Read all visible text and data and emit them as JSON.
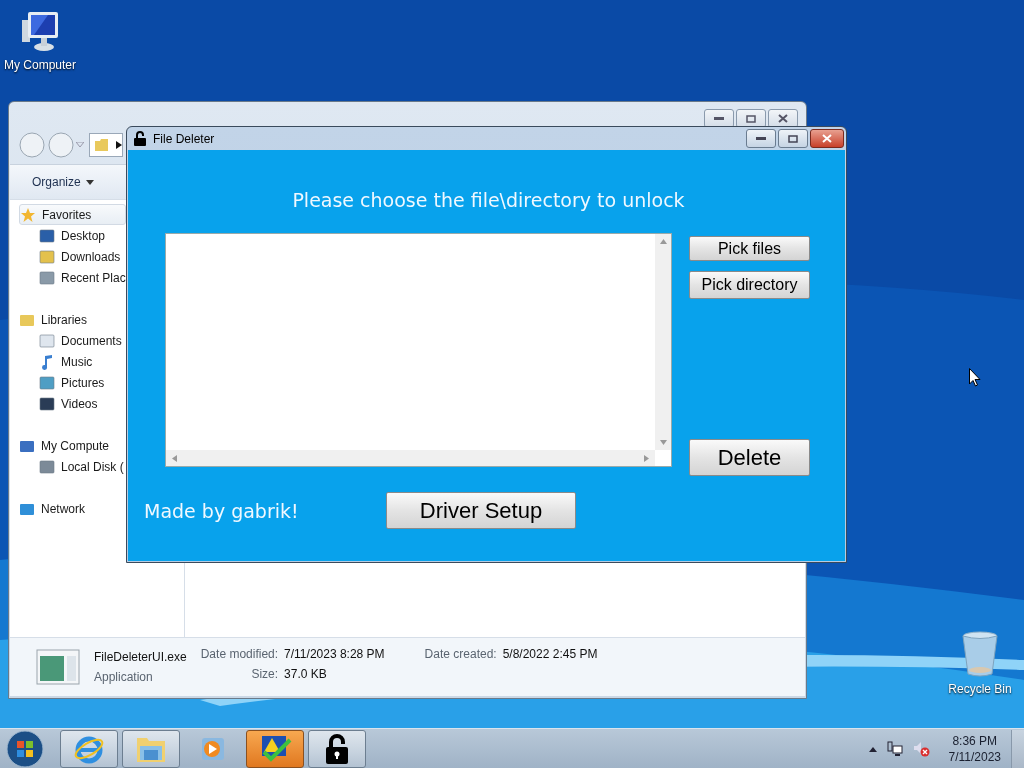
{
  "desktop_icons": [
    {
      "label": "My Computer",
      "kind": "computer"
    },
    {
      "label": "Recycle Bin",
      "kind": "bin"
    }
  ],
  "explorer": {
    "toolbar": {
      "organize": "Organize"
    },
    "nav_pane": [
      {
        "label": "Favorites",
        "kind": "star",
        "selected": true,
        "children": [
          {
            "label": "Desktop",
            "kind": "desktop",
            "selected": false
          },
          {
            "label": "Downloads",
            "kind": "downloads",
            "selected": false
          },
          {
            "label": "Recent Plac",
            "kind": "recent",
            "selected": false
          }
        ]
      },
      {
        "label": "Libraries",
        "kind": "library",
        "selected": false,
        "children": [
          {
            "label": "Documents",
            "kind": "documents",
            "selected": false
          },
          {
            "label": "Music",
            "kind": "music",
            "selected": false
          },
          {
            "label": "Pictures",
            "kind": "pictures",
            "selected": false
          },
          {
            "label": "Videos",
            "kind": "videos",
            "selected": false
          }
        ]
      },
      {
        "label": "My Compute",
        "kind": "computer",
        "selected": false,
        "children": [
          {
            "label": "Local Disk (",
            "kind": "disk",
            "selected": false
          }
        ]
      },
      {
        "label": "Network",
        "kind": "network",
        "selected": false
      }
    ],
    "details": {
      "name": "FileDeleterUI.exe",
      "type": "Application",
      "fields": [
        {
          "label": "Date modified:",
          "value": "7/11/2023 8:28 PM"
        },
        {
          "label": "Size:",
          "value": "37.0 KB"
        },
        {
          "label": "Date created:",
          "value": "5/8/2022 2:45 PM"
        }
      ]
    }
  },
  "app": {
    "title": "File Deleter",
    "heading": "Please choose the file\\directory to unlock",
    "side_buttons": [
      {
        "label": "Pick files"
      },
      {
        "label": "Pick directory"
      }
    ],
    "delete": "Delete",
    "driver_setup": "Driver Setup",
    "credit": "Made by gabrik!"
  },
  "taskbar": {
    "apps": [
      {
        "kind": "browser",
        "running": true,
        "highlighted": false
      },
      {
        "kind": "folder",
        "running": true,
        "highlighted": false
      },
      {
        "kind": "player",
        "running": false,
        "highlighted": false
      },
      {
        "kind": "warning",
        "running": true,
        "highlighted": true
      },
      {
        "kind": "lock",
        "running": true,
        "highlighted": false
      }
    ],
    "clock": {
      "time": "8:36 PM",
      "date": "7/11/2023"
    }
  }
}
